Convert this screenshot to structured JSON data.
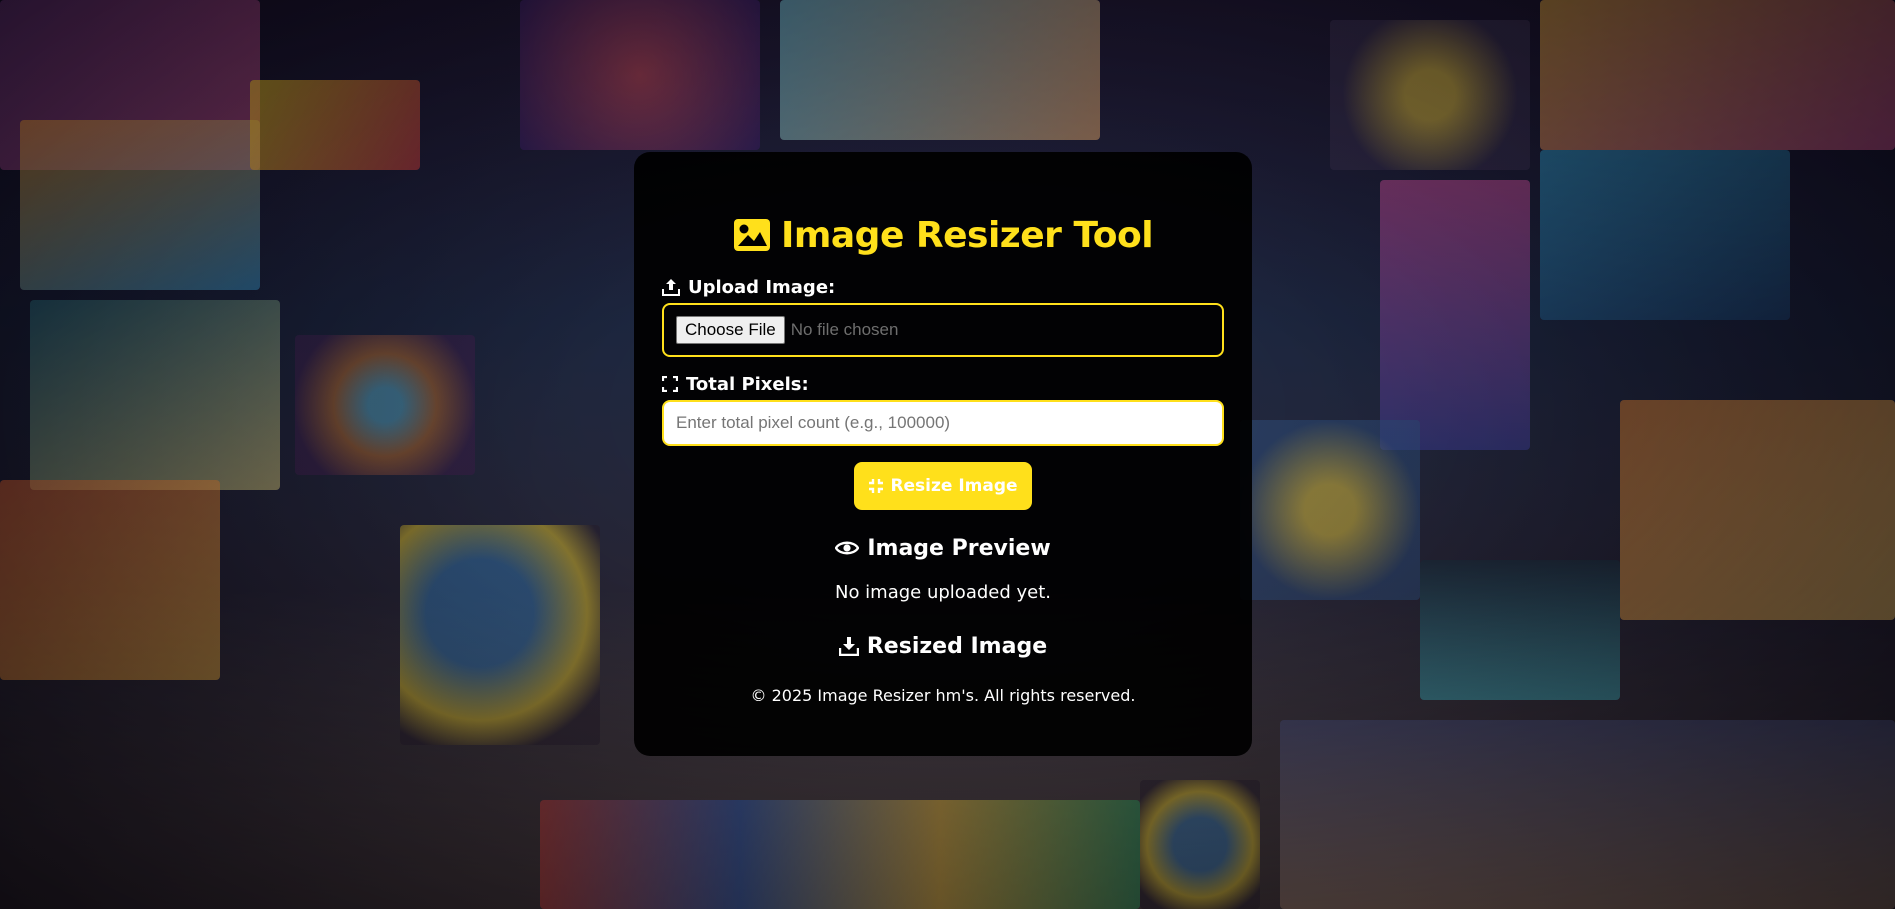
{
  "app": {
    "title": "Image Resizer Tool",
    "accent_color": "#ffe01b",
    "title_icon": "image-icon"
  },
  "upload": {
    "label": "Upload Image:",
    "icon": "upload-icon",
    "button_label": "Choose File",
    "status": "No file chosen"
  },
  "pixels": {
    "label": "Total Pixels:",
    "icon": "expand-icon",
    "placeholder": "Enter total pixel count (e.g., 100000)",
    "value": ""
  },
  "actions": {
    "resize_label": "Resize Image",
    "resize_icon": "compress-icon"
  },
  "preview": {
    "title": "Image Preview",
    "icon": "eye-icon",
    "empty_text": "No image uploaded yet."
  },
  "resized": {
    "title": "Resized Image",
    "icon": "download-icon"
  },
  "footer": {
    "text": "© 2025 Image Resizer hm's. All rights reserved."
  }
}
